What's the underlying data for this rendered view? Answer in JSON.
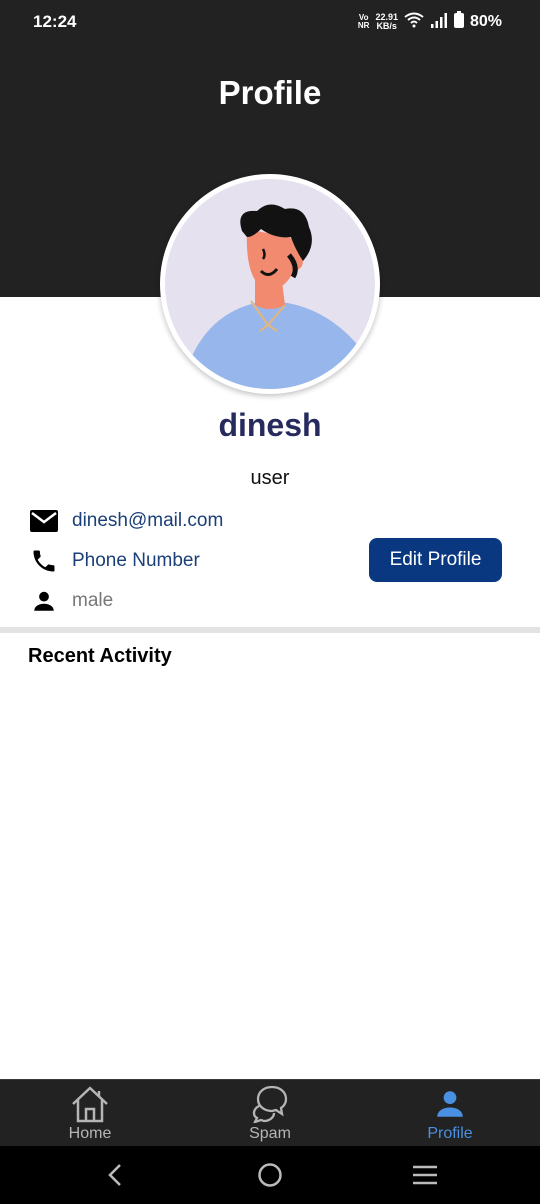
{
  "status_bar": {
    "time": "12:24",
    "network_top": "Vo",
    "network_bottom": "NR",
    "speed_value": "22.91",
    "speed_unit": "KB/s",
    "battery": "80%"
  },
  "header": {
    "title": "Profile"
  },
  "profile": {
    "name": "dinesh",
    "role": "user",
    "email": "dinesh@mail.com",
    "phone": "Phone Number",
    "gender": "male",
    "edit_label": "Edit Profile"
  },
  "recent_activity": {
    "title": "Recent Activity"
  },
  "bottom_nav": {
    "items": [
      {
        "label": "Home",
        "icon": "home-icon",
        "active": false
      },
      {
        "label": "Spam",
        "icon": "chat-bubble-icon",
        "active": false
      },
      {
        "label": "Profile",
        "icon": "person-icon",
        "active": true
      }
    ]
  },
  "colors": {
    "header_bg": "#222222",
    "name": "#262a5c",
    "link_blue": "#1b3f78",
    "button_bg": "#093880",
    "nav_active": "#4a90e2"
  }
}
